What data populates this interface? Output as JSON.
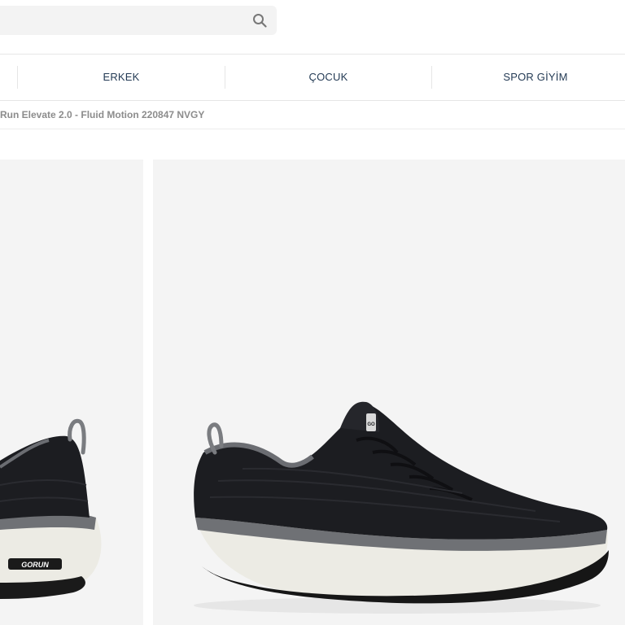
{
  "search": {
    "placeholder": "",
    "icon": "search-icon"
  },
  "nav": {
    "items": [
      {
        "label": "ERKEK"
      },
      {
        "label": "ÇOCUK"
      },
      {
        "label": "SPOR GİYİM"
      }
    ]
  },
  "breadcrumb": {
    "current": "Run Elevate 2.0 - Fluid Motion 220847 NVGY"
  },
  "gallery": {
    "images": [
      {
        "alt": "shoe-rear-view",
        "logo_text": "GORUN"
      },
      {
        "alt": "shoe-side-view",
        "logo_text": "GO"
      }
    ]
  },
  "colors": {
    "nav_text": "#243b55",
    "breadcrumb_text": "#8c8c8c",
    "image_bg": "#f4f4f4",
    "shoe_upper": "#1c1d21",
    "sole": "#ecebe4"
  }
}
